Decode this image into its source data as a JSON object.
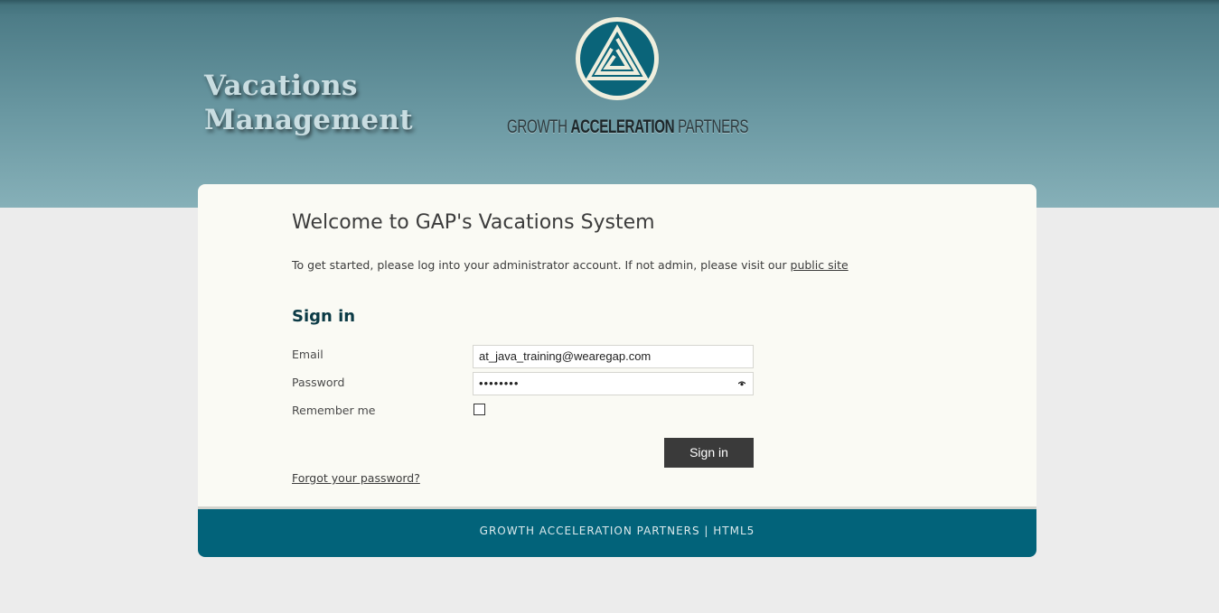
{
  "header": {
    "app_title_line1": "Vacations",
    "app_title_line2": "Management",
    "brand_part1": "GROWTH ",
    "brand_part2": "ACCELERATION",
    "brand_part3": " PARTNERS",
    "logo_icon": "triangle-spiral-logo-icon",
    "colors": {
      "header_top": "#3f6e78",
      "header_bottom": "#86b0b8",
      "logo_teal": "#0a6479"
    }
  },
  "main": {
    "welcome": "Welcome to GAP's Vacations System",
    "intro_text": "To get started, please log into your administrator account. If not admin, please visit our ",
    "public_site_link": "public site",
    "signin_heading": "Sign in"
  },
  "form": {
    "email_label": "Email",
    "email_value": "at_java_training@wearegap.com",
    "password_label": "Password",
    "password_value": "••••••••",
    "remember_label": "Remember me",
    "remember_checked": false,
    "signin_button": "Sign in",
    "forgot_link": "Forgot your password?"
  },
  "footer": {
    "text": "GROWTH ACCELERATION PARTNERS  |  HTML5",
    "color": "#02637a"
  }
}
